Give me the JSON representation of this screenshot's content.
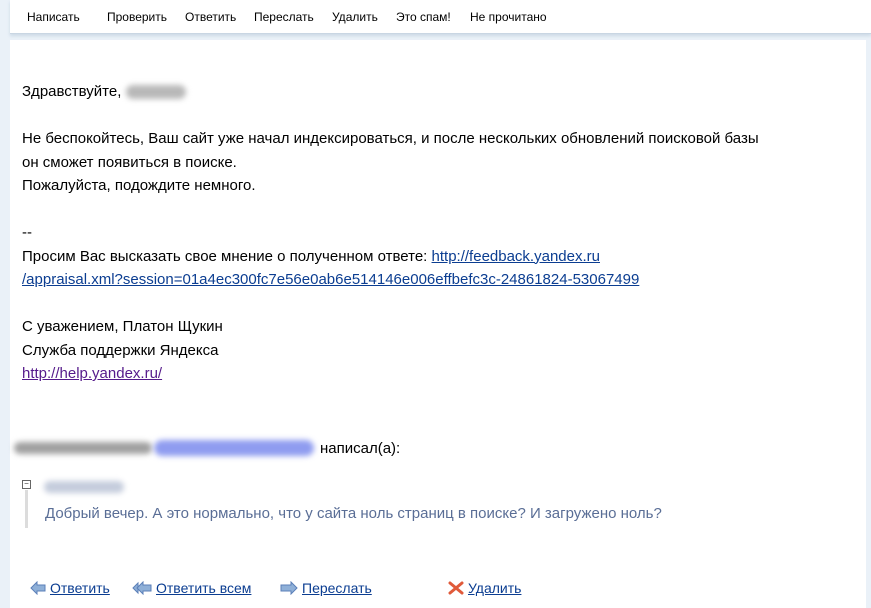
{
  "toolbar": {
    "compose": "Написать",
    "check": "Проверить",
    "reply": "Ответить",
    "forward": "Переслать",
    "delete": "Удалить",
    "spam": "Это спам!",
    "unread": "Не прочитано"
  },
  "message": {
    "greeting": "Здравствуйте,",
    "line1": "Не беспокойтесь, Ваш сайт уже начал индексироваться, и после нескольких обновлений поисковой базы",
    "line2": "он сможет появиться в поиске.",
    "line3": "Пожалуйста, подождите немного.",
    "separator": "--",
    "feedback_prompt": "Просим Вас высказать свое мнение о полученном ответе:",
    "feedback_url_1": "http://feedback.yandex.ru",
    "feedback_url_2": "/appraisal.xml?session=01a4ec300fc7e56e0ab6e514146e006effbefc3c-24861824-53067499",
    "regards": "С уважением, Платон Щукин",
    "team": "Служба поддержки Яндекса",
    "help_url": "http://help.yandex.ru/"
  },
  "quote": {
    "wrote": "написал(а):",
    "toggle": "−",
    "text": "Добрый вечер. А это нормально, что у сайта ноль страниц в поиске? И загружено ноль?"
  },
  "actions": {
    "reply": "Ответить",
    "reply_all": "Ответить всем",
    "forward": "Переслать",
    "delete": "Удалить"
  },
  "colors": {
    "link": "#0b3d91",
    "quote_text": "#5a6e96",
    "background": "#eaf1f8"
  }
}
